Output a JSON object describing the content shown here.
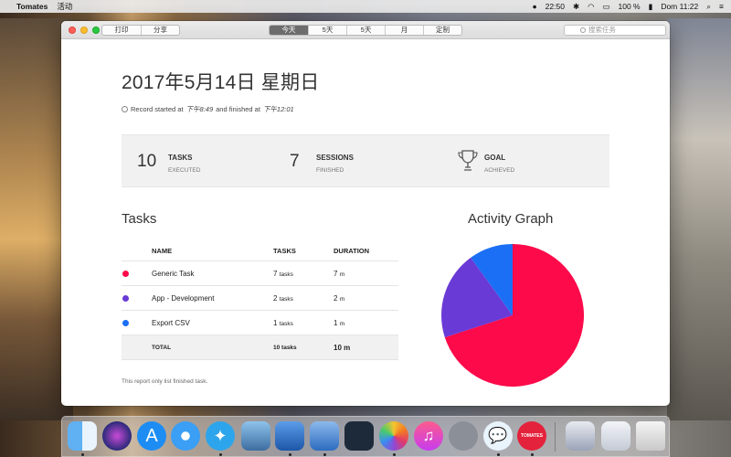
{
  "menubar": {
    "app_name": "Tomates",
    "menu_item": "活动",
    "time": "22:50",
    "battery": "100 %",
    "clock": "Dom 11:22"
  },
  "toolbar": {
    "print_label": "打印",
    "share_label": "分享",
    "tabs": [
      "今天",
      "5天",
      "5天",
      "月",
      "定制"
    ],
    "active_tab": "今天",
    "search_placeholder": "搜索任务"
  },
  "report": {
    "date": "2017年5月14日 星期日",
    "record_prefix": "Record started at",
    "start_time": "下午8:49",
    "record_mid": "and finished at",
    "end_time": "下午12:01"
  },
  "stats": {
    "tasks_count": "10",
    "tasks_label": "TASKS",
    "tasks_sub": "EXECUTED",
    "sessions_count": "7",
    "sessions_label": "SESSIONS",
    "sessions_sub": "FINISHED",
    "goal_label": "GOAL",
    "goal_sub": "ACHIEVED"
  },
  "tasks_section": {
    "title": "Tasks",
    "headers": {
      "name": "NAME",
      "tasks": "TASKS",
      "duration": "DURATION"
    },
    "rows": [
      {
        "name": "Generic Task",
        "tasks": "7",
        "tasks_unit": "tasks",
        "duration": "7",
        "duration_unit": "m",
        "color": "#fc0a4a"
      },
      {
        "name": "App - Development",
        "tasks": "2",
        "tasks_unit": "tasks",
        "duration": "2",
        "duration_unit": "m",
        "color": "#6a3ad6"
      },
      {
        "name": "Export CSV",
        "tasks": "1",
        "tasks_unit": "tasks",
        "duration": "1",
        "duration_unit": "m",
        "color": "#1b6ff5"
      }
    ],
    "total": {
      "label": "TOTAL",
      "tasks": "10 tasks",
      "duration": "10 m"
    },
    "note": "This report only list finished task."
  },
  "activity_graph": {
    "title": "Activity Graph"
  },
  "chart_data": {
    "type": "pie",
    "categories": [
      "Generic Task",
      "App - Development",
      "Export CSV"
    ],
    "values": [
      7,
      2,
      1
    ],
    "colors": [
      "#fc0a4a",
      "#6a3ad6",
      "#1b6ff5"
    ]
  },
  "dock": {
    "apps": [
      "finder-icon",
      "siri-icon",
      "app-store-icon",
      "safari-icon",
      "twitter-icon",
      "preview-icon",
      "xcode-icon",
      "xcode-beta-icon",
      "instruments-icon",
      "photos-icon",
      "itunes-icon",
      "launchpad-icon",
      "messages-icon",
      "tomates-icon",
      "stack-icon",
      "mail-icon",
      "trash-icon"
    ],
    "tomates_label": "TOMATES"
  }
}
